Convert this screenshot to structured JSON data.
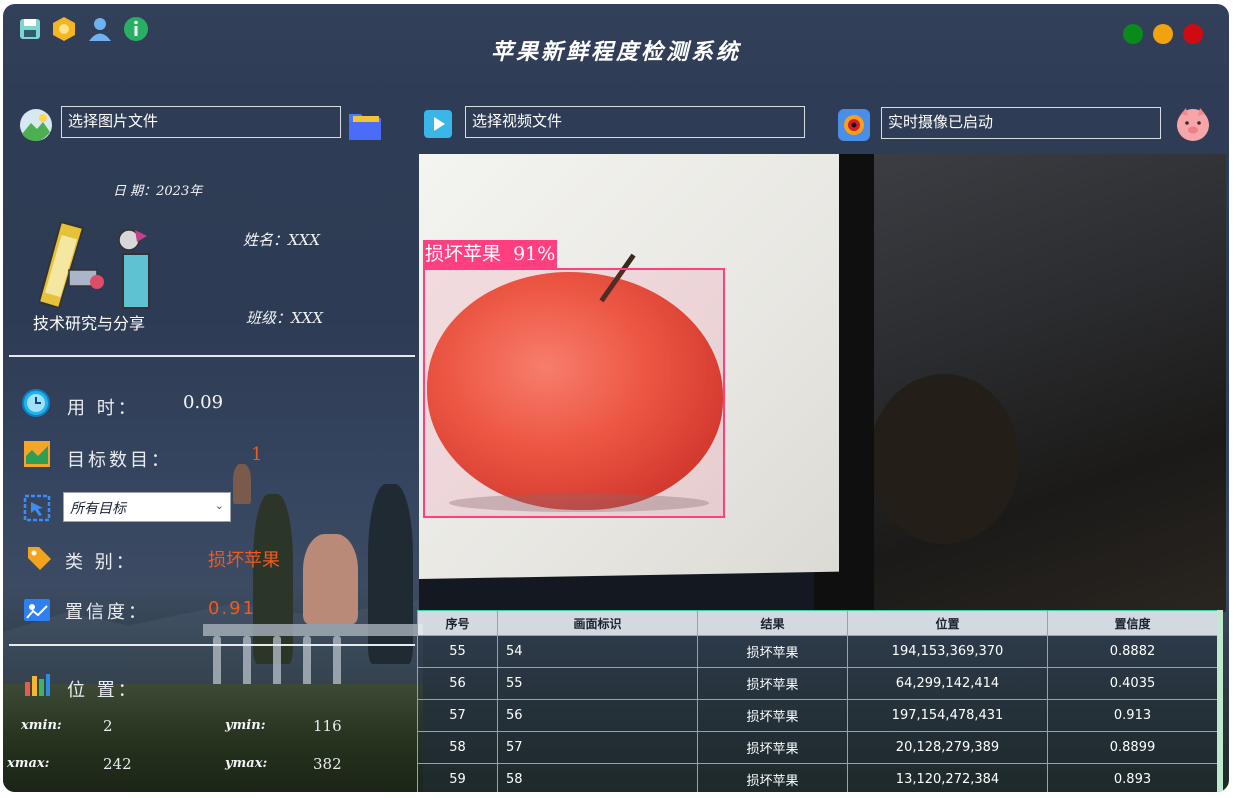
{
  "app": {
    "title": "苹果新鲜程度检测系统"
  },
  "toolbar_icons": [
    "save-icon",
    "hexagon-settings-icon",
    "user-icon",
    "info-icon"
  ],
  "window_controls": {
    "colors": [
      "#0a8a1d",
      "#f2a20c",
      "#cf0a12"
    ]
  },
  "inputs": {
    "image_file": "选择图片文件",
    "video_file": "选择视频文件",
    "camera": "实时摄像已启动"
  },
  "info": {
    "date": "日 期：2023年",
    "name": "姓名：XXX",
    "class": "班级：XXX",
    "logo_caption": "技术研究与分享"
  },
  "stats": {
    "time_label": "用 时：",
    "time_value": "0.09",
    "count_label": "目标数目：",
    "count_value": "1",
    "target_select": "所有目标",
    "category_label": "类 别：",
    "category_value": "损坏苹果",
    "confidence_label": "置信度：",
    "confidence_value": "0.91",
    "position_label": "位 置："
  },
  "position": {
    "xmin_label": "xmin:",
    "xmin": "2",
    "ymin_label": "ymin:",
    "ymin": "116",
    "xmax_label": "xmax:",
    "xmax": "242",
    "ymax_label": "ymax:",
    "ymax": "382"
  },
  "detection": {
    "label": "损坏苹果  91%",
    "box_color": "#ff3f7f"
  },
  "table": {
    "headers": [
      "序号",
      "画面标识",
      "结果",
      "位置",
      "置信度"
    ],
    "rows": [
      [
        "55",
        "54",
        "损坏苹果",
        "194,153,369,370",
        "0.8882"
      ],
      [
        "56",
        "55",
        "损坏苹果",
        "64,299,142,414",
        "0.4035"
      ],
      [
        "57",
        "56",
        "损坏苹果",
        "197,154,478,431",
        "0.913"
      ],
      [
        "58",
        "57",
        "损坏苹果",
        "20,128,279,389",
        "0.8899"
      ],
      [
        "59",
        "58",
        "损坏苹果",
        "13,120,272,384",
        "0.893"
      ]
    ]
  },
  "colors": {
    "accent_orange": "#f05a1e",
    "table_border": "#3bd3a4"
  }
}
